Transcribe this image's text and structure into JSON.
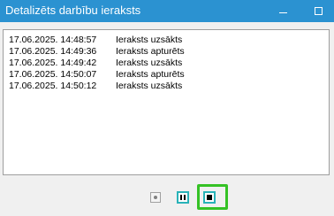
{
  "window": {
    "title": "Detalizēts darbību ieraksts"
  },
  "log": {
    "entries": [
      {
        "time": "17.06.2025. 14:48:57",
        "message": "Ieraksts uzsākts"
      },
      {
        "time": "17.06.2025. 14:49:36",
        "message": "Ieraksts apturēts"
      },
      {
        "time": "17.06.2025. 14:49:42",
        "message": "Ieraksts uzsākts"
      },
      {
        "time": "17.06.2025. 14:50:07",
        "message": "Ieraksts apturēts"
      },
      {
        "time": "17.06.2025. 14:50:12",
        "message": "Ieraksts uzsākts"
      }
    ]
  },
  "controls": {
    "record_icon": "record-icon",
    "pause_icon": "pause-icon",
    "stop_icon": "stop-icon",
    "highlight_color": "#35c225"
  },
  "colors": {
    "titlebar": "#2b92d1",
    "button_border": "#29b2b8"
  }
}
